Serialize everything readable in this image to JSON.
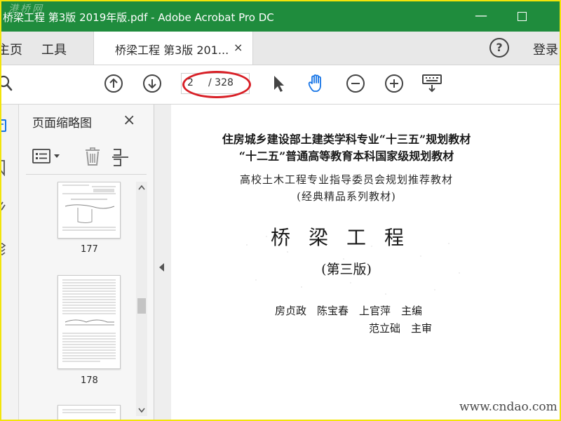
{
  "window": {
    "title": "桥梁工程 第3版 2019年版.pdf - Adobe Acrobat Pro DC",
    "minimize_glyph": "—",
    "watermark": "港桥网"
  },
  "nav": {
    "home_label": "主页",
    "tools_label": "工具",
    "document_tab_label": "桥梁工程 第3版 201...",
    "close_tab_glyph": "×",
    "help_glyph": "?",
    "login_label": "登录"
  },
  "toolbar": {
    "page_current": "2",
    "page_total": "/ 328",
    "highlight_color": "#d81f26",
    "hand_tool_color": "#1473e6"
  },
  "thumbnails": {
    "title": "页面缩略图",
    "close_glyph": "×",
    "pages": [
      {
        "number": "177"
      },
      {
        "number": "178"
      }
    ]
  },
  "document": {
    "line1": "住房城乡建设部土建类学科专业“十三五”规划教材",
    "line2": "“十二五”普通高等教育本科国家级规划教材",
    "line3": "高校土木工程专业指导委员会规划推荐教材",
    "line4": "(经典精品系列教材)",
    "title": "桥梁工程",
    "edition": "(第三版)",
    "authors": "房贞政　陈宝春　上官萍　主编",
    "reviewer": "范立础　主审"
  },
  "watermark_bottom": "www.cndao.com",
  "colors": {
    "titlebar": "#1f8c3d",
    "frame_border": "#f2e40a"
  }
}
